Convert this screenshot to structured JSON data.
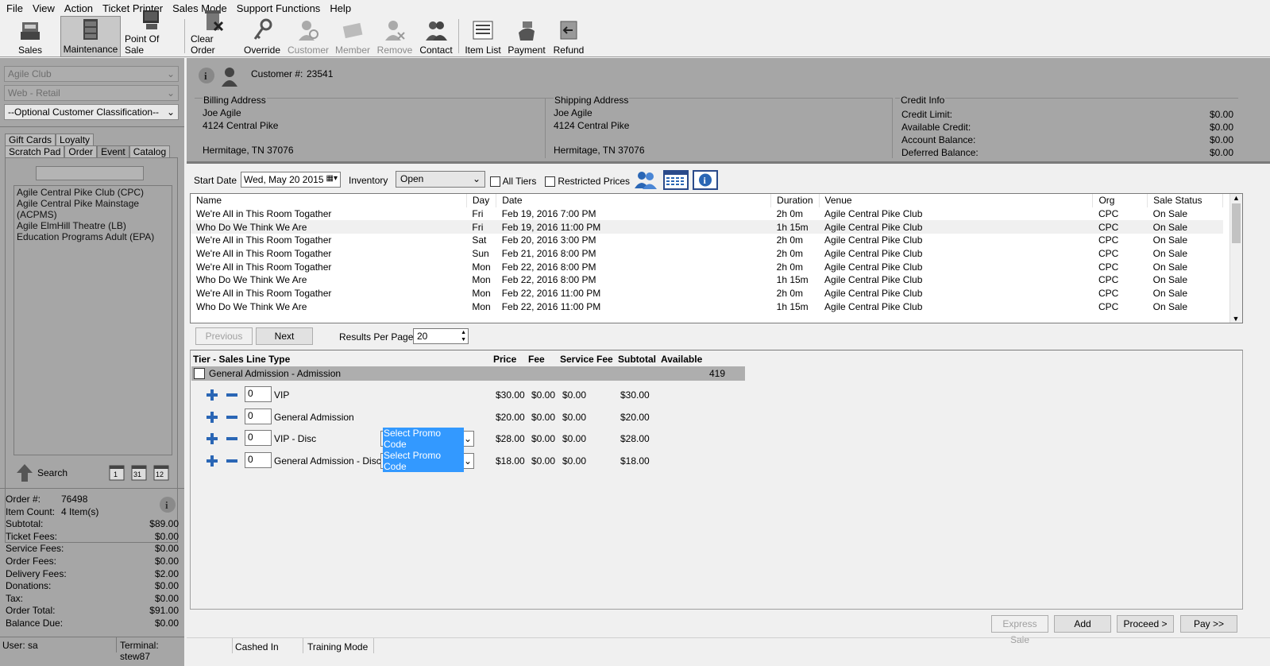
{
  "menu": [
    "File",
    "View",
    "Action",
    "Ticket Printer",
    "Sales Mode",
    "Support Functions",
    "Help"
  ],
  "toolbar": {
    "sales": "Sales",
    "maintenance": "Maintenance",
    "pos": "Point Of Sale",
    "clear": "Clear Order",
    "override": "Override",
    "customer": "Customer",
    "member": "Member",
    "remove": "Remove",
    "contact": "Contact",
    "itemlist": "Item List",
    "payment": "Payment",
    "refund": "Refund"
  },
  "left": {
    "combo1": "Agile Club",
    "combo2": "Web - Retail",
    "combo3": "--Optional Customer Classification--",
    "tabs_row1": [
      "Gift Cards",
      "Loyalty"
    ],
    "tabs_row2": [
      "Scratch Pad",
      "Order",
      "Event",
      "Catalog"
    ],
    "search_value": "",
    "orgs": [
      "Agile Central Pike Club  (CPC)",
      "Agile Central Pike Mainstage  (ACPMS)",
      "Agile ElmHill Theatre  (LB)",
      "Education Programs Adult  (EPA)"
    ],
    "search_label": "Search",
    "summary": [
      [
        "Order #:",
        "76498",
        ""
      ],
      [
        "Item Count:",
        "4 Item(s)",
        ""
      ],
      [
        "Subtotal:",
        "",
        "$89.00"
      ],
      [
        "Ticket Fees:",
        "",
        "$0.00"
      ],
      [
        "Service Fees:",
        "",
        "$0.00"
      ],
      [
        "Order Fees:",
        "",
        "$0.00"
      ],
      [
        "Delivery Fees:",
        "",
        "$2.00"
      ],
      [
        "Donations:",
        "",
        "$0.00"
      ],
      [
        "Tax:",
        "",
        "$0.00"
      ],
      [
        "Order Total:",
        "",
        "$91.00"
      ],
      [
        "Balance Due:",
        "",
        "$0.00"
      ]
    ],
    "user": "User:  sa",
    "terminal": "Terminal:  stew87"
  },
  "customer": {
    "label": "Customer #:",
    "number": "23541",
    "billing": {
      "title": "Billing Address",
      "name": "Joe Agile",
      "street": "4124 Central Pike",
      "city": "Hermitage, TN 37076"
    },
    "shipping": {
      "title": "Shipping Address",
      "name": "Joe Agile",
      "street": "4124 Central Pike",
      "city": "Hermitage, TN 37076"
    },
    "credit": {
      "title": "Credit Info",
      "rows": [
        [
          "Credit Limit:",
          "$0.00"
        ],
        [
          "Available Credit:",
          "$0.00"
        ],
        [
          "Account Balance:",
          "$0.00"
        ],
        [
          "Deferred Balance:",
          "$0.00"
        ]
      ]
    }
  },
  "filters": {
    "start_label": "Start Date",
    "start_value": "Wed, May 20 2015",
    "inventory_label": "Inventory",
    "inventory_value": "Open",
    "all_tiers": "All Tiers",
    "restricted": "Restricted Prices"
  },
  "events": {
    "headers": [
      "Name",
      "Day",
      "Date",
      "Duration",
      "Venue",
      "Org",
      "Sale Status"
    ],
    "rows": [
      [
        "We're All in This Room Togather",
        "Fri",
        "Feb 19, 2016 7:00 PM",
        "2h 0m",
        "Agile Central Pike Club",
        "CPC",
        "On Sale"
      ],
      [
        "Who Do We Think We Are",
        "Fri",
        "Feb 19, 2016 11:00 PM",
        "1h 15m",
        "Agile Central Pike Club",
        "CPC",
        "On Sale"
      ],
      [
        "We're All in This Room Togather",
        "Sat",
        "Feb 20, 2016 3:00 PM",
        "2h 0m",
        "Agile Central Pike Club",
        "CPC",
        "On Sale"
      ],
      [
        "We're All in This Room Togather",
        "Sun",
        "Feb 21, 2016 8:00 PM",
        "2h 0m",
        "Agile Central Pike Club",
        "CPC",
        "On Sale"
      ],
      [
        "We're All in This Room Togather",
        "Mon",
        "Feb 22, 2016 8:00 PM",
        "2h 0m",
        "Agile Central Pike Club",
        "CPC",
        "On Sale"
      ],
      [
        "Who Do We Think We Are",
        "Mon",
        "Feb 22, 2016 8:00 PM",
        "1h 15m",
        "Agile Central Pike Club",
        "CPC",
        "On Sale"
      ],
      [
        "We're All in This Room Togather",
        "Mon",
        "Feb 22, 2016 11:00 PM",
        "2h 0m",
        "Agile Central Pike Club",
        "CPC",
        "On Sale"
      ],
      [
        "Who Do We Think We Are",
        "Mon",
        "Feb 22, 2016 11:00 PM",
        "1h 15m",
        "Agile Central Pike Club",
        "CPC",
        "On Sale"
      ]
    ]
  },
  "paging": {
    "previous": "Previous",
    "next": "Next",
    "rpp_label": "Results Per Page:",
    "rpp_value": "20"
  },
  "tiers": {
    "headers": [
      "Tier - Sales Line Type",
      "Price",
      "Fee",
      "Service Fee",
      "Subtotal",
      "Available"
    ],
    "group": "General Admission - Admission",
    "available": "419",
    "lines": [
      {
        "qty": "0",
        "name": "VIP",
        "promo": "",
        "price": "$30.00",
        "fee": "$0.00",
        "svc": "$0.00",
        "sub": "$30.00"
      },
      {
        "qty": "0",
        "name": "General Admission",
        "promo": "",
        "price": "$20.00",
        "fee": "$0.00",
        "svc": "$0.00",
        "sub": "$20.00"
      },
      {
        "qty": "0",
        "name": "VIP - Disc",
        "promo": "Select Promo Code",
        "price": "$28.00",
        "fee": "$0.00",
        "svc": "$0.00",
        "sub": "$28.00"
      },
      {
        "qty": "0",
        "name": "General Admission - Disc",
        "promo": "Select Promo Code",
        "price": "$18.00",
        "fee": "$0.00",
        "svc": "$0.00",
        "sub": "$18.00"
      }
    ]
  },
  "bottom": {
    "express": "Express Sale",
    "add": "Add",
    "proceed": "Proceed >",
    "pay": "Pay >>"
  },
  "status": {
    "cashed": "Cashed In",
    "training": "Training Mode"
  }
}
